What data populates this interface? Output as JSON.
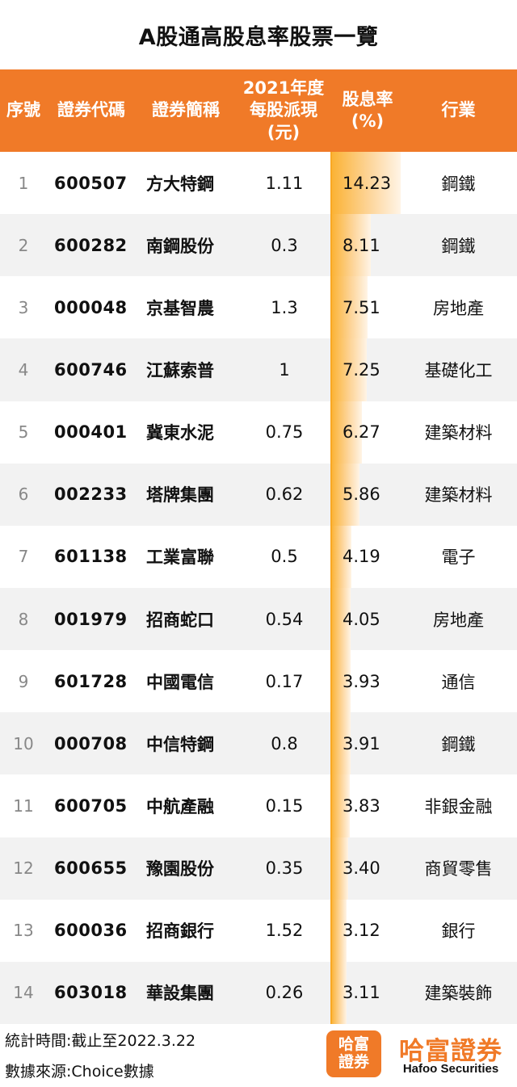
{
  "title": "A股通高股息率股票一覽",
  "headers": {
    "idx": "序號",
    "code": "證券代碼",
    "name": "證券簡稱",
    "dividend": [
      "2021年度",
      "每股派現",
      "(元)"
    ],
    "yield": [
      "股息率",
      "(%)"
    ],
    "industry": "行業"
  },
  "chart_data": {
    "type": "table",
    "title": "A股通高股息率股票一覽",
    "columns": [
      "序號",
      "證券代碼",
      "證券簡稱",
      "2021年度每股派現(元)",
      "股息率(%)",
      "行業"
    ],
    "bar_color": "#fbb233",
    "header_color": "#f07a28",
    "rows": [
      {
        "idx": "1",
        "code": "600507",
        "name": "方大特鋼",
        "dividend": "1.11",
        "yield": "14.23",
        "industry": "鋼鐵"
      },
      {
        "idx": "2",
        "code": "600282",
        "name": "南鋼股份",
        "dividend": "0.3",
        "yield": "8.11",
        "industry": "鋼鐵"
      },
      {
        "idx": "3",
        "code": "000048",
        "name": "京基智農",
        "dividend": "1.3",
        "yield": "7.51",
        "industry": "房地產"
      },
      {
        "idx": "4",
        "code": "600746",
        "name": "江蘇索普",
        "dividend": "1",
        "yield": "7.25",
        "industry": "基礎化工"
      },
      {
        "idx": "5",
        "code": "000401",
        "name": "冀東水泥",
        "dividend": "0.75",
        "yield": "6.27",
        "industry": "建築材料"
      },
      {
        "idx": "6",
        "code": "002233",
        "name": "塔牌集團",
        "dividend": "0.62",
        "yield": "5.86",
        "industry": "建築材料"
      },
      {
        "idx": "7",
        "code": "601138",
        "name": "工業富聯",
        "dividend": "0.5",
        "yield": "4.19",
        "industry": "電子"
      },
      {
        "idx": "8",
        "code": "001979",
        "name": "招商蛇口",
        "dividend": "0.54",
        "yield": "4.05",
        "industry": "房地產"
      },
      {
        "idx": "9",
        "code": "601728",
        "name": "中國電信",
        "dividend": "0.17",
        "yield": "3.93",
        "industry": "通信"
      },
      {
        "idx": "10",
        "code": "000708",
        "name": "中信特鋼",
        "dividend": "0.8",
        "yield": "3.91",
        "industry": "鋼鐵"
      },
      {
        "idx": "11",
        "code": "600705",
        "name": "中航產融",
        "dividend": "0.15",
        "yield": "3.83",
        "industry": "非銀金融"
      },
      {
        "idx": "12",
        "code": "600655",
        "name": "豫園股份",
        "dividend": "0.35",
        "yield": "3.40",
        "industry": "商貿零售"
      },
      {
        "idx": "13",
        "code": "600036",
        "name": "招商銀行",
        "dividend": "1.52",
        "yield": "3.12",
        "industry": "銀行"
      },
      {
        "idx": "14",
        "code": "603018",
        "name": "華設集團",
        "dividend": "0.26",
        "yield": "3.11",
        "industry": "建築裝飾"
      }
    ]
  },
  "footer": {
    "stat_time": "統計時間:截止至2022.3.22",
    "source": "數據來源:Choice數據",
    "logo_box_line1": "哈富",
    "logo_box_line2": "證券",
    "brand_cn": "哈富證券",
    "brand_en": "Hafoo Securities"
  }
}
